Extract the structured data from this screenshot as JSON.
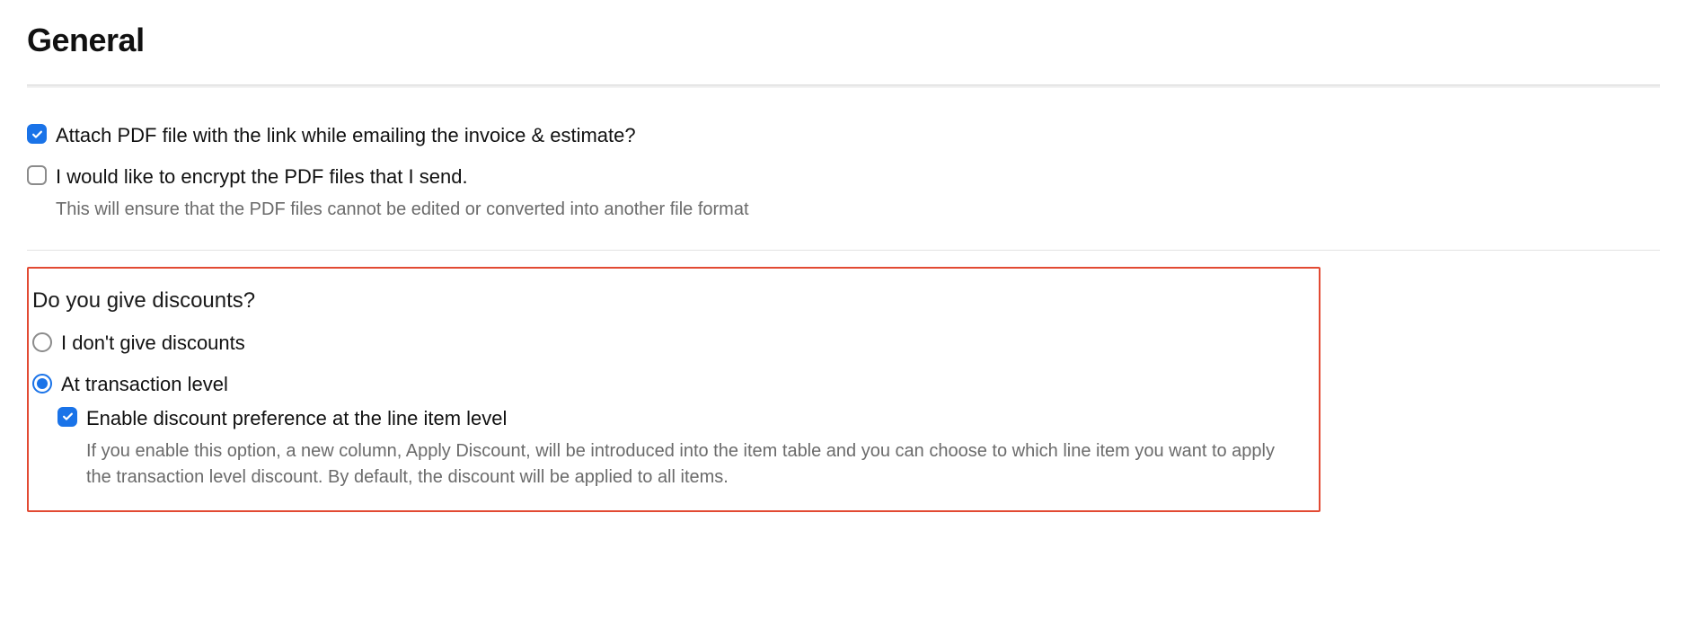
{
  "header": {
    "title": "General"
  },
  "pdf": {
    "attach_label": "Attach PDF file with the link while emailing the invoice & estimate?",
    "encrypt_label": "I would like to encrypt the PDF files that I send.",
    "encrypt_help": "This will ensure that the PDF files cannot be edited or converted into another file format"
  },
  "discounts": {
    "heading": "Do you give discounts?",
    "options": [
      {
        "label": "I don't give discounts"
      },
      {
        "label": "At transaction level"
      }
    ],
    "line_item": {
      "label": "Enable discount preference at the line item level",
      "help": "If you enable this option, a new column, Apply Discount, will be introduced into the item table and you can choose to which line item you want to apply the transaction level discount. By default, the discount will be applied to all items."
    }
  }
}
